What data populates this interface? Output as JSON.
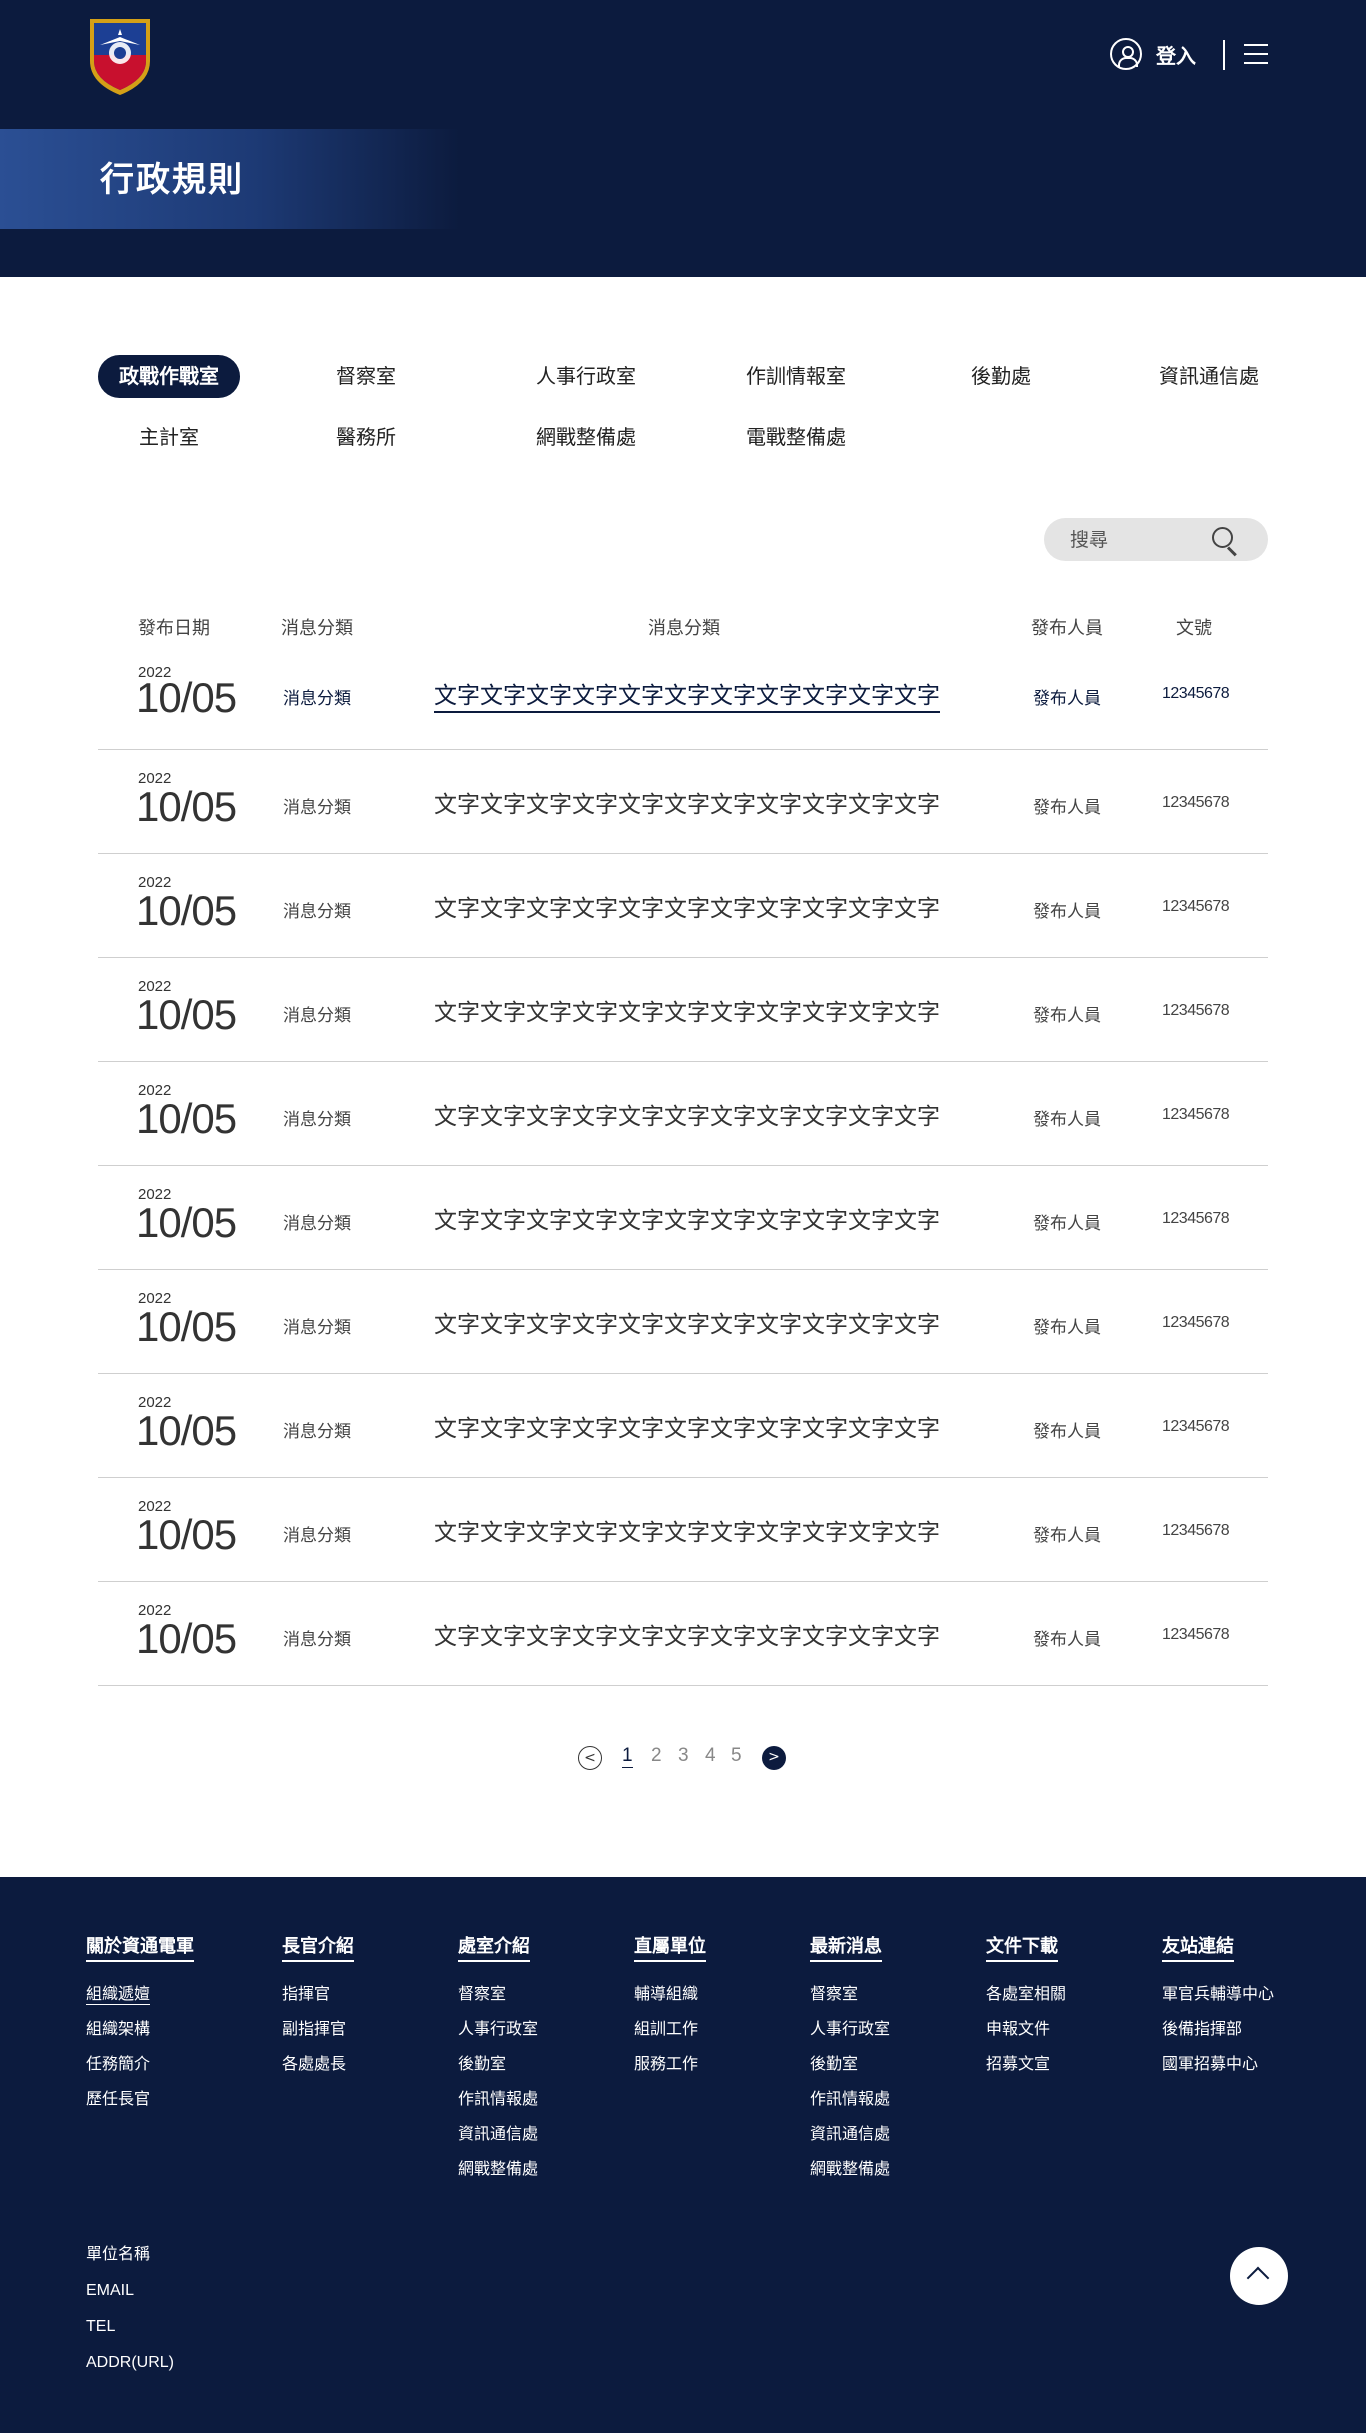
{
  "header": {
    "login_label": "登入",
    "page_title": "行政規則"
  },
  "tabs": [
    {
      "label": "政戰作戰室",
      "active": true
    },
    {
      "label": "督察室"
    },
    {
      "label": "人事行政室"
    },
    {
      "label": "作訓情報室"
    },
    {
      "label": "後勤處"
    },
    {
      "label": "資訊通信處"
    },
    {
      "label": "主計室"
    },
    {
      "label": "醫務所"
    },
    {
      "label": "網戰整備處"
    },
    {
      "label": "電戰整備處"
    }
  ],
  "search": {
    "placeholder": "搜尋"
  },
  "table": {
    "headers": {
      "date": "發布日期",
      "category": "消息分類",
      "title": "消息分類",
      "publisher": "發布人員",
      "doc_no": "文號"
    },
    "rows": [
      {
        "year": "2022",
        "date": "10/05",
        "category": "消息分類",
        "title": "文字文字文字文字文字文字文字文字文字文字文字",
        "publisher": "發布人員",
        "doc_no": "12345678"
      },
      {
        "year": "2022",
        "date": "10/05",
        "category": "消息分類",
        "title": "文字文字文字文字文字文字文字文字文字文字文字",
        "publisher": "發布人員",
        "doc_no": "12345678"
      },
      {
        "year": "2022",
        "date": "10/05",
        "category": "消息分類",
        "title": "文字文字文字文字文字文字文字文字文字文字文字",
        "publisher": "發布人員",
        "doc_no": "12345678"
      },
      {
        "year": "2022",
        "date": "10/05",
        "category": "消息分類",
        "title": "文字文字文字文字文字文字文字文字文字文字文字",
        "publisher": "發布人員",
        "doc_no": "12345678"
      },
      {
        "year": "2022",
        "date": "10/05",
        "category": "消息分類",
        "title": "文字文字文字文字文字文字文字文字文字文字文字",
        "publisher": "發布人員",
        "doc_no": "12345678"
      },
      {
        "year": "2022",
        "date": "10/05",
        "category": "消息分類",
        "title": "文字文字文字文字文字文字文字文字文字文字文字",
        "publisher": "發布人員",
        "doc_no": "12345678"
      },
      {
        "year": "2022",
        "date": "10/05",
        "category": "消息分類",
        "title": "文字文字文字文字文字文字文字文字文字文字文字",
        "publisher": "發布人員",
        "doc_no": "12345678"
      },
      {
        "year": "2022",
        "date": "10/05",
        "category": "消息分類",
        "title": "文字文字文字文字文字文字文字文字文字文字文字",
        "publisher": "發布人員",
        "doc_no": "12345678"
      },
      {
        "year": "2022",
        "date": "10/05",
        "category": "消息分類",
        "title": "文字文字文字文字文字文字文字文字文字文字文字",
        "publisher": "發布人員",
        "doc_no": "12345678"
      },
      {
        "year": "2022",
        "date": "10/05",
        "category": "消息分類",
        "title": "文字文字文字文字文字文字文字文字文字文字文字",
        "publisher": "發布人員",
        "doc_no": "12345678"
      }
    ]
  },
  "pagination": {
    "prev_label": "<",
    "next_label": ">",
    "pages": [
      "1",
      "2",
      "3",
      "4",
      "5"
    ],
    "current": "1"
  },
  "footer": {
    "columns": [
      {
        "heading": "關於資通電軍",
        "links": [
          "組織遞嬗",
          "組織架構",
          "任務簡介",
          "歷任長官"
        ]
      },
      {
        "heading": "長官介紹",
        "links": [
          "指揮官",
          "副指揮官",
          "各處處長"
        ]
      },
      {
        "heading": "處室介紹",
        "links": [
          "督察室",
          "人事行政室",
          "後勤室",
          "作訊情報處",
          "資訊通信處",
          "網戰整備處"
        ]
      },
      {
        "heading": "直屬單位",
        "links": [
          "輔導組織",
          "組訓工作",
          "服務工作"
        ]
      },
      {
        "heading": "最新消息",
        "links": [
          "督察室",
          "人事行政室",
          "後勤室",
          "作訊情報處",
          "資訊通信處",
          "網戰整備處"
        ]
      },
      {
        "heading": "文件下載",
        "links": [
          "各處室相關",
          "申報文件",
          "招募文宣"
        ]
      },
      {
        "heading": "友站連結",
        "links": [
          "軍官兵輔導中心",
          "後備指揮部",
          "國軍招募中心"
        ]
      }
    ],
    "info": [
      "單位名稱",
      "EMAIL",
      "TEL",
      "ADDR(URL)"
    ]
  },
  "colors": {
    "navy": "#0c1b3e",
    "band_blue": "#2b4f94",
    "logo_red": "#c8102e",
    "logo_blue": "#1c3f94",
    "logo_gold": "#d4a017"
  }
}
